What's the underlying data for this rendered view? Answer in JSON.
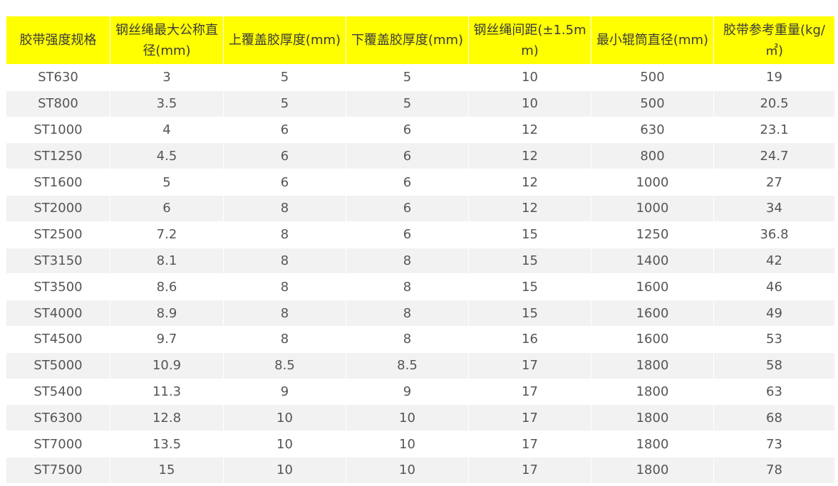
{
  "table": {
    "headers": [
      "胶带强度规格",
      "钢丝绳最大公称直径(mm)",
      "上覆盖胶厚度(mm)",
      "下覆盖胶厚度(mm)",
      "钢丝绳间距(±1.5mm)",
      "最小辊筒直径(mm)",
      "胶带参考重量(kg/㎡)"
    ],
    "rows": [
      [
        "ST630",
        "3",
        "5",
        "5",
        "10",
        "500",
        "19"
      ],
      [
        "ST800",
        "3.5",
        "5",
        "5",
        "10",
        "500",
        "20.5"
      ],
      [
        "ST1000",
        "4",
        "6",
        "6",
        "12",
        "630",
        "23.1"
      ],
      [
        "ST1250",
        "4.5",
        "6",
        "6",
        "12",
        "800",
        "24.7"
      ],
      [
        "ST1600",
        "5",
        "6",
        "6",
        "12",
        "1000",
        "27"
      ],
      [
        "ST2000",
        "6",
        "8",
        "6",
        "12",
        "1000",
        "34"
      ],
      [
        "ST2500",
        "7.2",
        "8",
        "6",
        "15",
        "1250",
        "36.8"
      ],
      [
        "ST3150",
        "8.1",
        "8",
        "8",
        "15",
        "1400",
        "42"
      ],
      [
        "ST3500",
        "8.6",
        "8",
        "8",
        "15",
        "1600",
        "46"
      ],
      [
        "ST4000",
        "8.9",
        "8",
        "8",
        "15",
        "1600",
        "49"
      ],
      [
        "ST4500",
        "9.7",
        "8",
        "8",
        "16",
        "1600",
        "53"
      ],
      [
        "ST5000",
        "10.9",
        "8.5",
        "8.5",
        "17",
        "1800",
        "58"
      ],
      [
        "ST5400",
        "11.3",
        "9",
        "9",
        "17",
        "1800",
        "63"
      ],
      [
        "ST6300",
        "12.8",
        "10",
        "10",
        "17",
        "1800",
        "68"
      ],
      [
        "ST7000",
        "13.5",
        "10",
        "10",
        "17",
        "1800",
        "73"
      ],
      [
        "ST7500",
        "15",
        "10",
        "10",
        "17",
        "1800",
        "78"
      ]
    ]
  },
  "colors": {
    "header_background": "#ffff00",
    "header_text": "#3b3b3b",
    "row_odd": "#ffffff",
    "row_even": "#f2f2f2",
    "cell_text": "#555555"
  }
}
